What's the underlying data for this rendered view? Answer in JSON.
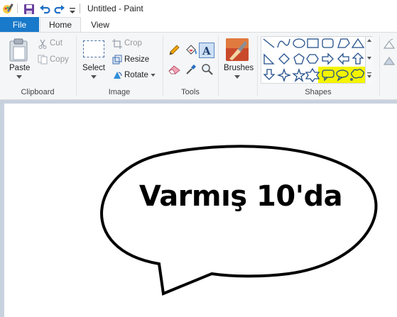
{
  "window": {
    "title": "Untitled - Paint"
  },
  "tabs": {
    "file": "File",
    "home": "Home",
    "view": "View"
  },
  "clipboard": {
    "paste": "Paste",
    "cut": "Cut",
    "copy": "Copy",
    "group": "Clipboard"
  },
  "image": {
    "select": "Select",
    "crop": "Crop",
    "resize": "Resize",
    "rotate": "Rotate",
    "group": "Image"
  },
  "tools": {
    "group": "Tools"
  },
  "brushes": {
    "label": "Brushes"
  },
  "shapes": {
    "group": "Shapes",
    "highlight_color": "#f4f400"
  },
  "canvas": {
    "text": "Varmış 10'da"
  },
  "colors": {
    "accent": "#1979ca",
    "ribbon_bg": "#f5f6f7",
    "workspace_bg": "#c8d1de"
  }
}
